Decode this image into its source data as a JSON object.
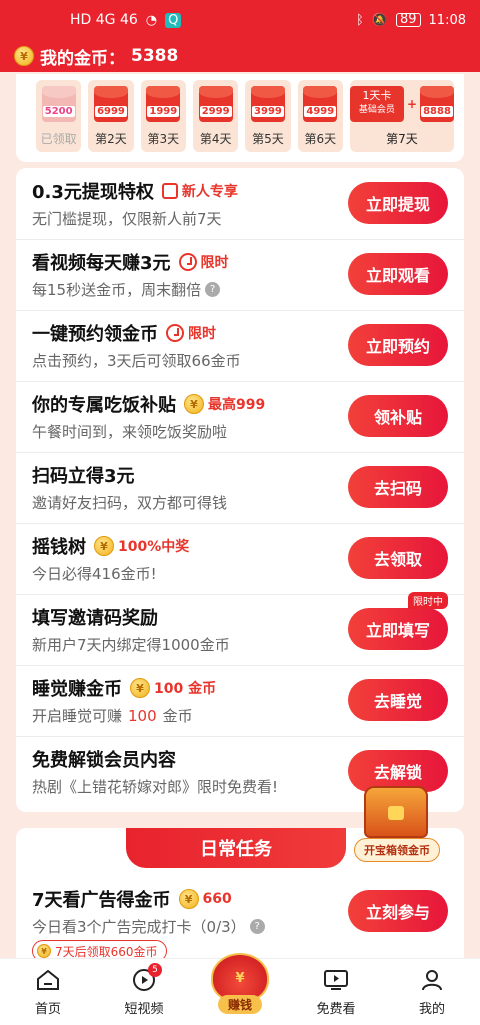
{
  "status": {
    "left": "HD 4G 46",
    "time": "11:08",
    "battery": "89"
  },
  "header": {
    "coin_label": "我的金币：",
    "coin_value": "5388"
  },
  "signin": {
    "days": [
      {
        "amount": "5200",
        "label": "已领取",
        "done": true
      },
      {
        "amount": "6999",
        "label": "第2天"
      },
      {
        "amount": "1999",
        "label": "第3天"
      },
      {
        "amount": "2999",
        "label": "第4天"
      },
      {
        "amount": "3999",
        "label": "第5天"
      },
      {
        "amount": "4999",
        "label": "第6天"
      }
    ],
    "day7": {
      "vip_title": "1天卡",
      "vip_sub": "基础会员",
      "plus": "+",
      "amount": "8888",
      "label": "第7天"
    }
  },
  "tasks": [
    {
      "title": "0.3元提现特权",
      "badge": "新人专享",
      "sub": "无门槛提现，仅限新人前7天",
      "button": "立即提现"
    },
    {
      "title": "看视频每天赚3元",
      "badge": "限时",
      "sub": "每15秒送金币，周末翻倍",
      "button": "立即观看"
    },
    {
      "title": "一键预约领金币",
      "badge": "限时",
      "sub": "点击预约，3天后可领取66金币",
      "button": "立即预约"
    },
    {
      "title": "你的专属吃饭补贴",
      "badge": "最高999",
      "sub": "午餐时间到，来领吃饭奖励啦",
      "button": "领补贴"
    },
    {
      "title": "扫码立得3元",
      "sub": "邀请好友扫码，双方都可得钱",
      "button": "去扫码"
    },
    {
      "title": "摇钱树",
      "badge": "100%中奖",
      "sub": "今日必得416金币!",
      "button": "去领取"
    },
    {
      "title": "填写邀请码奖励",
      "sub": "新用户7天内绑定得1000金币",
      "button": "立即填写",
      "tag": "限时中"
    },
    {
      "title": "睡觉赚金币",
      "badge": "100 金币",
      "sub_pre": "开启睡觉可赚",
      "sub_hl": "100",
      "sub_post": "金币",
      "button": "去睡觉"
    },
    {
      "title": "免费解锁会员内容",
      "sub": "热剧《上错花轿嫁对郎》限时免费看!",
      "button": "去解锁"
    }
  ],
  "chest": {
    "label": "开宝箱领金币"
  },
  "daily": {
    "header": "日常任务",
    "title": "7天看广告得金币",
    "badge": "660",
    "sub": "今日看3个广告完成打卡（0/3）",
    "button": "立刻参与",
    "pill": "7天后领取660金币"
  },
  "tabbar": {
    "home": "首页",
    "video": "短视频",
    "video_badge": "5",
    "earn_top": "¥",
    "earn": "赚钱",
    "free": "免费看",
    "mine": "我的"
  }
}
